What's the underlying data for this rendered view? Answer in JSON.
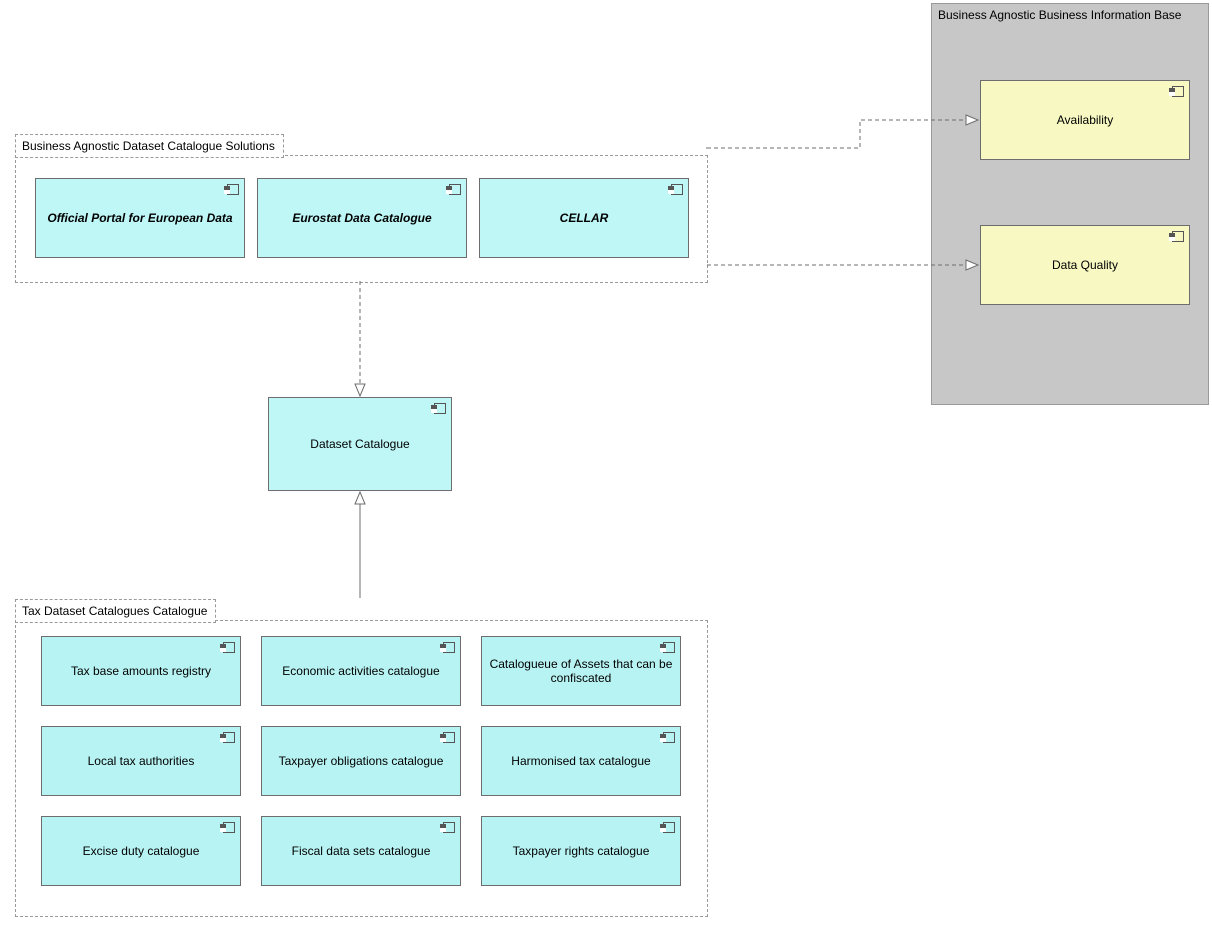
{
  "groups": {
    "solutions": {
      "label": "Business Agnostic Dataset Catalogue Solutions",
      "items": [
        {
          "id": "portal",
          "label": "Official Portal for European Data",
          "italic": true
        },
        {
          "id": "eurostat",
          "label": "Eurostat Data Catalogue",
          "italic": true
        },
        {
          "id": "cellar",
          "label": "CELLAR",
          "italic": true
        }
      ]
    },
    "info_base": {
      "label": "Business Agnostic Business Information Base",
      "items": [
        {
          "id": "availability",
          "label": "Availability"
        },
        {
          "id": "dataquality",
          "label": "Data Quality"
        }
      ]
    },
    "tax": {
      "label": "Tax Dataset Catalogues Catalogue",
      "items": [
        {
          "id": "t1",
          "label": "Tax base amounts registry"
        },
        {
          "id": "t2",
          "label": "Economic activities catalogue"
        },
        {
          "id": "t3",
          "label": "Catalogueue of Assets that can be confiscated"
        },
        {
          "id": "t4",
          "label": "Local tax authorities"
        },
        {
          "id": "t5",
          "label": "Taxpayer obligations catalogue"
        },
        {
          "id": "t6",
          "label": "Harmonised tax catalogue"
        },
        {
          "id": "t7",
          "label": "Excise duty catalogue"
        },
        {
          "id": "t8",
          "label": "Fiscal data sets catalogue"
        },
        {
          "id": "t9",
          "label": "Taxpayer rights catalogue"
        }
      ]
    }
  },
  "center_node": {
    "label": "Dataset Catalogue"
  }
}
